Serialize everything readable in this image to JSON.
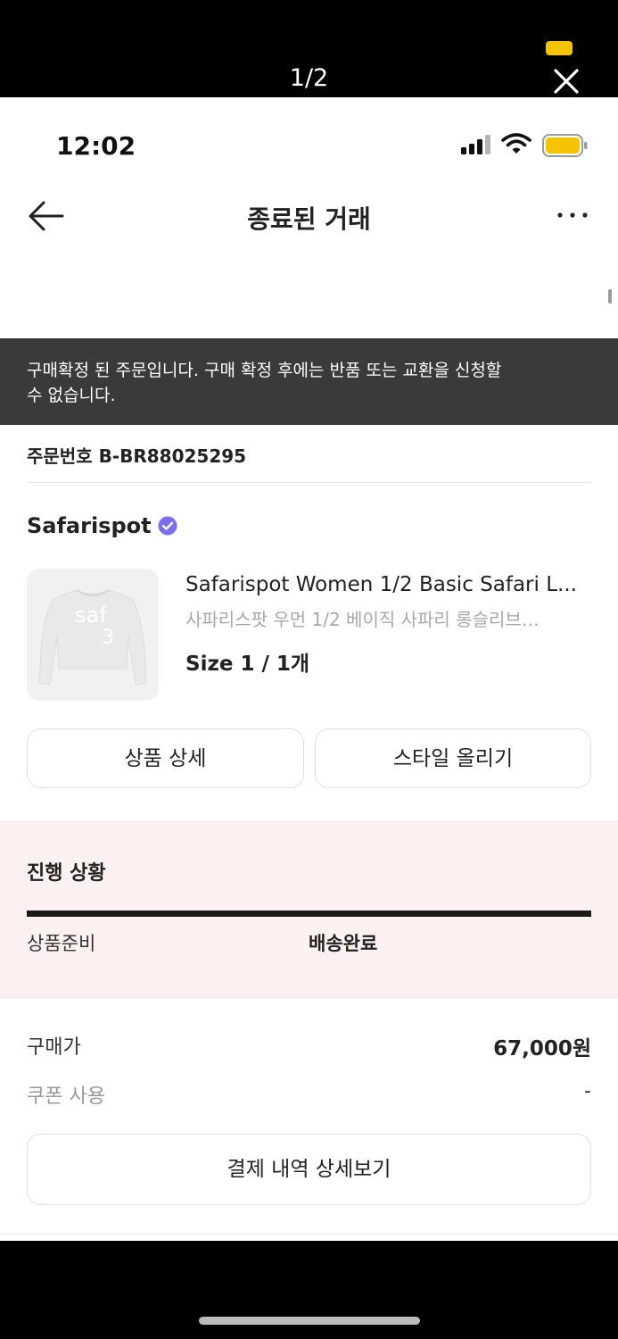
{
  "viewer": {
    "counter": "1/2",
    "indicator_color": "#f5c400",
    "close_icon": "close-icon"
  },
  "status_bar": {
    "time": "12:02",
    "icons": [
      "signal-icon",
      "wifi-icon",
      "battery-icon"
    ],
    "battery_color": "#f5c400"
  },
  "header": {
    "title": "종료된 거래",
    "back_icon": "back-arrow-icon",
    "more_icon": "more-icon"
  },
  "notice": {
    "line1": "구매확정 된 주문입니다. 구매 확정 후에는 반품 또는 교환을 신청할",
    "line2": "수 없습니다."
  },
  "order": {
    "number": "주문번호 B-BR88025295"
  },
  "seller": {
    "name": "Safarispot",
    "verified_icon": "verified-badge-icon",
    "verified_color": "#7b6ff0"
  },
  "product": {
    "name": "Safarispot Women 1/2 Basic Safari L...",
    "name_ko": "사파리스팟 우먼 1/2 베이직 사파리 롱슬리브…",
    "size": "Size 1 / 1개",
    "thumb_text_1": "saf",
    "thumb_text_2": "3"
  },
  "actions": {
    "detail": "상품 상세",
    "style": "스타일 올리기"
  },
  "progress": {
    "title": "진행 상황",
    "step1": "상품준비",
    "step2": "배송완료",
    "fraction": 1.0
  },
  "price": {
    "label": "구매가",
    "value": "67,000원",
    "coupon_label": "쿠폰 사용",
    "coupon_value": "-"
  },
  "payment": {
    "button": "결제 내역 상세보기"
  }
}
